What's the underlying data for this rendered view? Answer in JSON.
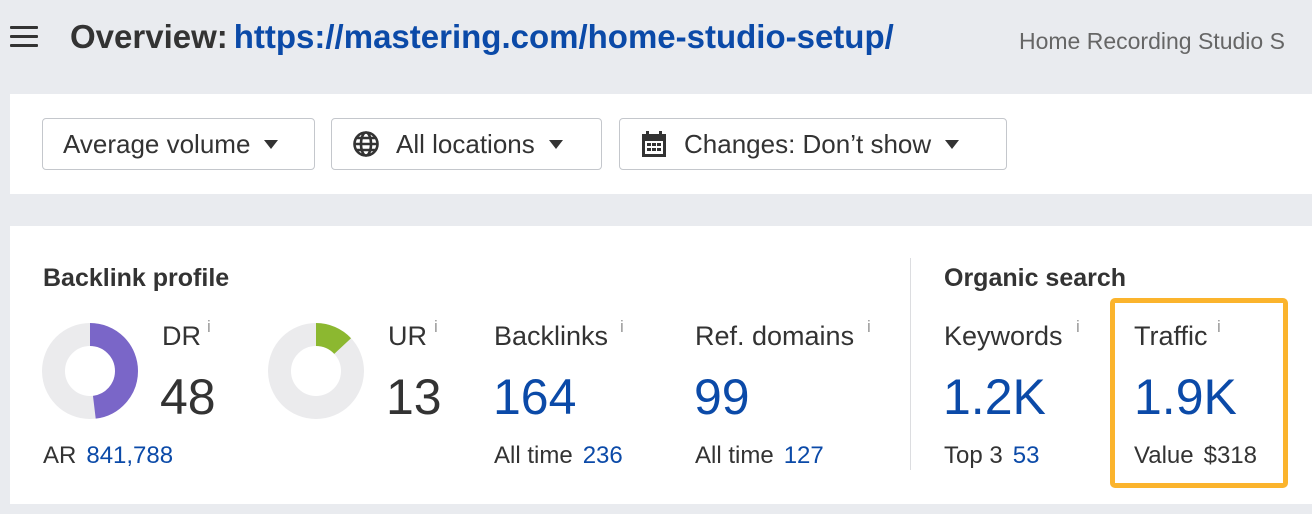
{
  "header": {
    "title_prefix": "Overview:",
    "url": "https://mastering.com/home-studio-setup/",
    "page_name": "Home Recording Studio S"
  },
  "filters": {
    "volume": "Average volume",
    "locations": "All locations",
    "changes": "Changes: Don’t show"
  },
  "backlink_profile": {
    "title": "Backlink profile",
    "dr": {
      "label": "DR",
      "value": "48",
      "info": "i"
    },
    "ar": {
      "label": "AR",
      "value": "841,788"
    },
    "ur": {
      "label": "UR",
      "value": "13",
      "info": "i"
    },
    "backlinks": {
      "label": "Backlinks",
      "value": "164",
      "info": "i",
      "sub_label": "All time",
      "sub_value": "236"
    },
    "ref_domains": {
      "label": "Ref. domains",
      "value": "99",
      "info": "i",
      "sub_label": "All time",
      "sub_value": "127"
    }
  },
  "organic_search": {
    "title": "Organic search",
    "keywords": {
      "label": "Keywords",
      "value": "1.2K",
      "info": "i",
      "sub_label": "Top 3",
      "sub_value": "53"
    },
    "traffic": {
      "label": "Traffic",
      "value": "1.9K",
      "info": "i",
      "sub_label": "Value",
      "sub_value": "$318"
    }
  },
  "gauges": {
    "dr_fraction": 0.48,
    "ur_fraction": 0.13,
    "dr_color": "#7a66c8",
    "ur_color": "#8cb830",
    "track_color": "#ebebed"
  },
  "colors": {
    "link": "#0b4aa8",
    "highlight": "#fbb42d"
  }
}
